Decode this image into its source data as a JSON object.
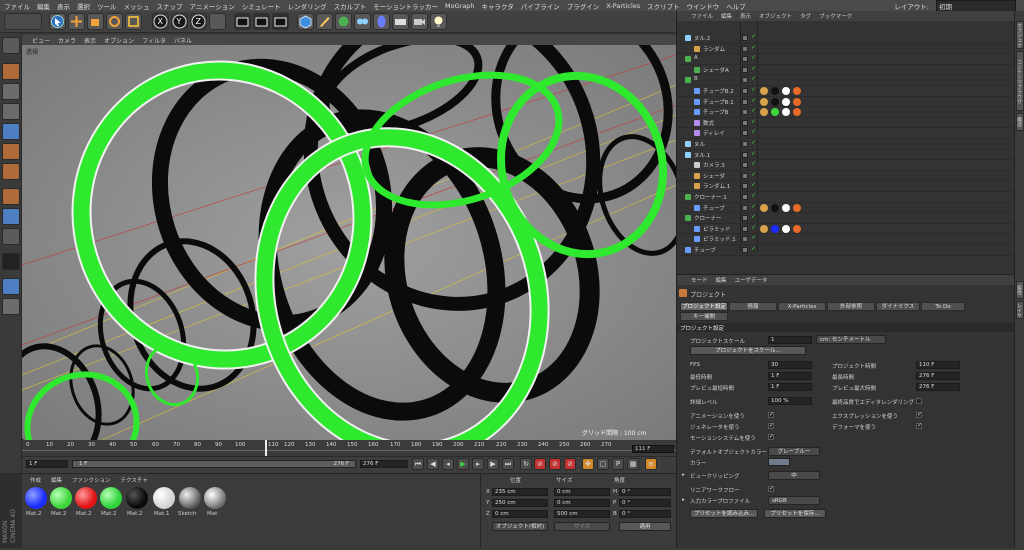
{
  "menu": {
    "items": [
      "ファイル",
      "編集",
      "表示",
      "選択",
      "ツール",
      "メッシュ",
      "スナップ",
      "アニメーション",
      "シミュレート",
      "レンダリング",
      "スカルプト",
      "モーショントラッカー",
      "MoGraph",
      "キャラクタ",
      "パイプライン",
      "プラグイン",
      "X-Particles",
      "スクリプト",
      "ウインドウ",
      "ヘルプ"
    ],
    "layout_label": "レイアウト:",
    "layout_value": "初期"
  },
  "toolbar": {
    "axis_x": "X",
    "axis_y": "Y",
    "axis_z": "Z"
  },
  "viewport": {
    "menu": [
      "ビュー",
      "カメラ",
      "表示",
      "オプション",
      "フィルタ",
      "パネル"
    ],
    "view_name": "透視",
    "grid_label": "グリッド間隔 : 100 cm"
  },
  "timeline": {
    "ticks": [
      "0",
      "10",
      "20",
      "30",
      "40",
      "50",
      "60",
      "70",
      "80",
      "90",
      "100",
      "110",
      "120",
      "130",
      "140",
      "150",
      "160",
      "170",
      "180",
      "190",
      "200",
      "210",
      "220",
      "230",
      "240",
      "250",
      "260",
      "270"
    ],
    "current_label": "111 F",
    "start": "1 F",
    "range_start": "1 F",
    "range_end": "276 F",
    "end": "276 F"
  },
  "materials": {
    "menu": [
      "作成",
      "編集",
      "ファンクション",
      "テクスチャ"
    ],
    "items": [
      {
        "name": "Mat.2",
        "color": "#1a2cff"
      },
      {
        "name": "Mat.2",
        "color": "#3ed63a"
      },
      {
        "name": "Mat.2",
        "color": "#e11414"
      },
      {
        "name": "Mat.2",
        "color": "#2fd23a"
      },
      {
        "name": "Mat.2",
        "color": "#0a0a0a"
      },
      {
        "name": "Mat.1",
        "color": "#f3f3f3"
      },
      {
        "name": "Sketch",
        "color": "#9a9a9a"
      },
      {
        "name": "Mat",
        "color": "#b8b8b8"
      }
    ]
  },
  "coords": {
    "headers": [
      "位置",
      "サイズ",
      "角度"
    ],
    "rows": [
      {
        "axis": "X",
        "pos": "235 cm",
        "size": "0 cm",
        "rotl": "H",
        "rot": "0 °"
      },
      {
        "axis": "Y",
        "pos": "250 cm",
        "size": "0 cm",
        "rotl": "P",
        "rot": "0 °"
      },
      {
        "axis": "Z",
        "pos": "0 cm",
        "size": "500 cm",
        "rotl": "B",
        "rot": "0 °"
      }
    ],
    "mode": "オブジェクト(相対)",
    "size_mode": "サイズ",
    "apply": "適用"
  },
  "objects": {
    "menu": [
      "ファイル",
      "編集",
      "表示",
      "オブジェクト",
      "タグ",
      "ブックマーク"
    ],
    "rows": [
      {
        "name": "ヌル.2",
        "indent": 0
      },
      {
        "name": "ランダム",
        "indent": 1
      },
      {
        "name": "A",
        "indent": 0
      },
      {
        "name": "シェーダA",
        "indent": 1
      },
      {
        "name": "B",
        "indent": 0
      },
      {
        "name": "チューブB.2",
        "indent": 1
      },
      {
        "name": "チューブB.1",
        "indent": 1
      },
      {
        "name": "チューブB",
        "indent": 1
      },
      {
        "name": "数式",
        "indent": 1
      },
      {
        "name": "ディレイ",
        "indent": 1
      },
      {
        "name": "ヌル",
        "indent": 0
      },
      {
        "name": "ヌル.1",
        "indent": 0
      },
      {
        "name": "カメラ.3",
        "indent": 1
      },
      {
        "name": "シェーダ",
        "indent": 1
      },
      {
        "name": "ランダム.1",
        "indent": 1
      },
      {
        "name": "クローナー.1",
        "indent": 0
      },
      {
        "name": "チューブ",
        "indent": 1
      },
      {
        "name": "クローナー",
        "indent": 0
      },
      {
        "name": "ピラミッド",
        "indent": 1
      },
      {
        "name": "ピラミッド.1",
        "indent": 1
      },
      {
        "name": "チューブ",
        "indent": 0
      }
    ]
  },
  "attributes": {
    "menu": [
      "モード",
      "編集",
      "ユーザデータ"
    ],
    "object_label": "プロジェクト",
    "tabs": [
      "プロジェクト設定",
      "情報",
      "X-Particles",
      "外部参照",
      "ダイナミクス",
      "To Do"
    ],
    "subtab": "キー補間",
    "section": "プロジェクト設定",
    "scale_label": "プロジェクトスケール",
    "scale_value": "1",
    "scale_unit": "cm: センチメートル",
    "scale_button": "プロジェクトをスケール...",
    "fps_label": "FPS",
    "fps_value": "30",
    "min_time_label": "最低時間",
    "min_time_value": "1 F",
    "preview_min_label": "プレビュ最短時間",
    "preview_min_value": "1 F",
    "project_time_label": "プロジェクト時間",
    "project_time_value": "110 F",
    "max_time_label": "最長時間",
    "max_time_value": "276 F",
    "preview_max_label": "プレビュ最大時間",
    "preview_max_value": "276 F",
    "lod_label": "詳細レベル",
    "lod_value": "100 %",
    "render_lod_label": "最終品質でエディタレンダリング",
    "anim_label": "アニメーションを使う",
    "generators_label": "ジェネレータを使う",
    "motion_label": "モーションシステムを使う",
    "expressions_label": "エクスプレッションを使う",
    "deformers_label": "デフォーマを使う",
    "default_color_label": "デフォルトオブジェクトカラー",
    "default_color_value": "グレーブルー",
    "color_label": "カラー",
    "clipping_label": "ビュークリッピング",
    "clipping_value": "中",
    "linear_label": "リニアワークフロー",
    "input_profile_label": "入力カラープロファイル",
    "input_profile_value": "sRGB",
    "load_preset": "プリセットを読み込み...",
    "save_preset": "プリセットを保存..."
  },
  "right_tabs": [
    "オブジェクト",
    "コンテンツブラウザ",
    "構造",
    "属性",
    "レイヤ"
  ]
}
